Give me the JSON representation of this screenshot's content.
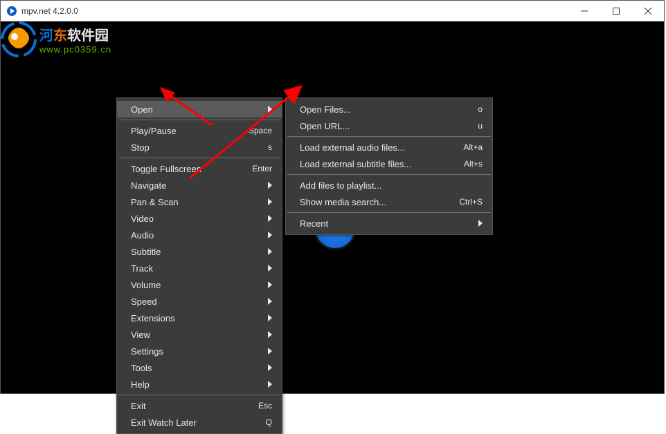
{
  "titlebar": {
    "title": "mpv.net 4.2.0.0"
  },
  "watermark": {
    "cn1": "河",
    "cn2": "东",
    "cn3": "软件园",
    "url": "www.pc0359.cn"
  },
  "mainMenu": {
    "open": {
      "label": "Open"
    },
    "playPause": {
      "label": "Play/Pause",
      "shortcut": "Space"
    },
    "stop": {
      "label": "Stop",
      "shortcut": "s"
    },
    "fullscreen": {
      "label": "Toggle Fullscreen",
      "shortcut": "Enter"
    },
    "navigate": {
      "label": "Navigate"
    },
    "panScan": {
      "label": "Pan & Scan"
    },
    "video": {
      "label": "Video"
    },
    "audio": {
      "label": "Audio"
    },
    "subtitle": {
      "label": "Subtitle"
    },
    "track": {
      "label": "Track"
    },
    "volume": {
      "label": "Volume"
    },
    "speed": {
      "label": "Speed"
    },
    "extensions": {
      "label": "Extensions"
    },
    "view": {
      "label": "View"
    },
    "settings": {
      "label": "Settings"
    },
    "tools": {
      "label": "Tools"
    },
    "help": {
      "label": "Help"
    },
    "exit": {
      "label": "Exit",
      "shortcut": "Esc"
    },
    "exitWatch": {
      "label": "Exit Watch Later",
      "shortcut": "Q"
    }
  },
  "subMenu": {
    "openFiles": {
      "label": "Open Files...",
      "shortcut": "o"
    },
    "openUrl": {
      "label": "Open URL...",
      "shortcut": "u"
    },
    "loadAudio": {
      "label": "Load external audio files...",
      "shortcut": "Alt+a"
    },
    "loadSubs": {
      "label": "Load external subtitle files...",
      "shortcut": "Alt+s"
    },
    "addPlaylist": {
      "label": "Add files to playlist..."
    },
    "mediaSearch": {
      "label": "Show media search...",
      "shortcut": "Ctrl+S"
    },
    "recent": {
      "label": "Recent"
    }
  }
}
